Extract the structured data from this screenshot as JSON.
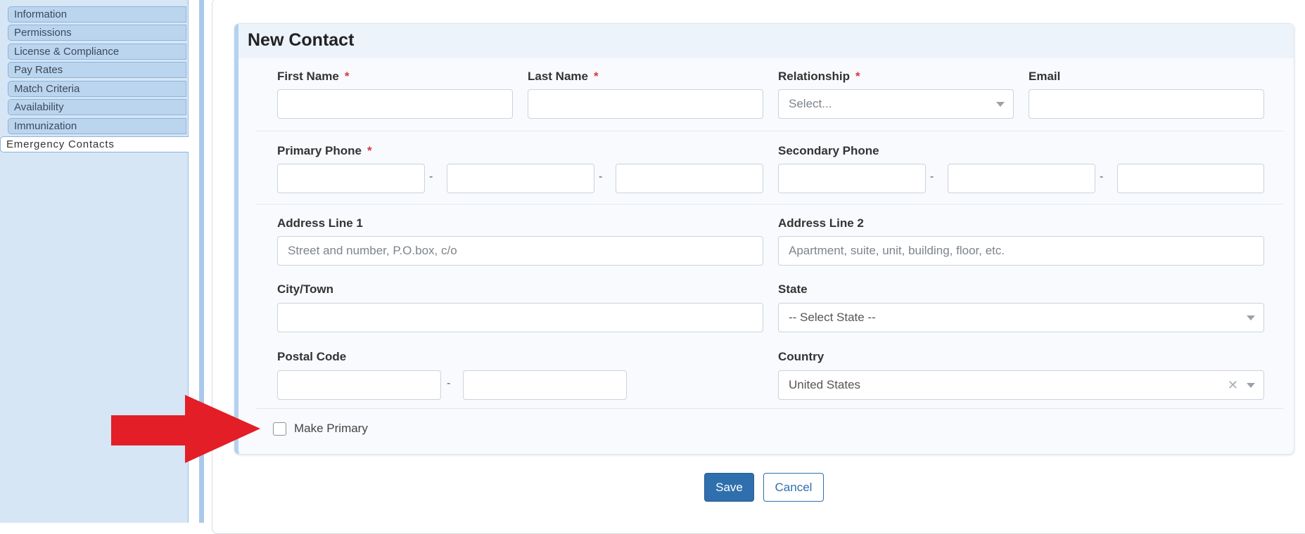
{
  "sidebar": {
    "items": [
      {
        "label": "Information"
      },
      {
        "label": "Permissions"
      },
      {
        "label": "License & Compliance"
      },
      {
        "label": "Pay Rates"
      },
      {
        "label": "Match Criteria"
      },
      {
        "label": "Availability"
      },
      {
        "label": "Immunization"
      },
      {
        "label": "Emergency Contacts"
      }
    ],
    "active_index": 7
  },
  "form": {
    "title": "New Contact",
    "required_mark": "*",
    "first_name": {
      "label": "First Name",
      "value": ""
    },
    "last_name": {
      "label": "Last Name",
      "value": ""
    },
    "relationship": {
      "label": "Relationship",
      "placeholder": "Select..."
    },
    "email": {
      "label": "Email",
      "value": ""
    },
    "primary_phone": {
      "label": "Primary Phone",
      "separator": "-"
    },
    "secondary_phone": {
      "label": "Secondary Phone",
      "separator": "-"
    },
    "address_line_1": {
      "label": "Address Line 1",
      "placeholder": "Street and number, P.O.box, c/o"
    },
    "address_line_2": {
      "label": "Address Line 2",
      "placeholder": "Apartment, suite, unit, building, floor, etc."
    },
    "city": {
      "label": "City/Town",
      "value": ""
    },
    "state": {
      "label": "State",
      "placeholder": "-- Select State --"
    },
    "postal_code": {
      "label": "Postal Code",
      "separator": "-"
    },
    "country": {
      "label": "Country",
      "value": "United States",
      "clear": "✕"
    },
    "make_primary": {
      "label": "Make Primary",
      "checked": false
    }
  },
  "actions": {
    "save_label": "Save",
    "cancel_label": "Cancel"
  },
  "colors": {
    "accent": "#2f6fad",
    "required": "#d9363e",
    "annotation_arrow": "#e41e26",
    "sidebar_bg": "#d6e6f5"
  }
}
